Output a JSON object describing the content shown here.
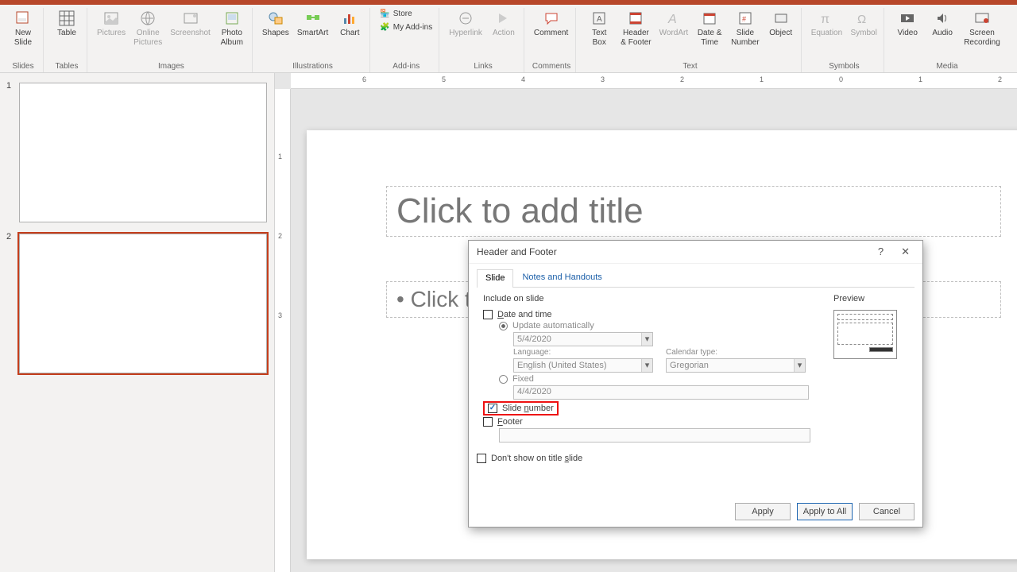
{
  "ribbon": {
    "groups": {
      "slides": {
        "label": "Slides",
        "new_slide": "New\nSlide"
      },
      "tables": {
        "label": "Tables",
        "table": "Table"
      },
      "images": {
        "label": "Images",
        "pictures": "Pictures",
        "online": "Online\nPictures",
        "screenshot": "Screenshot",
        "photo": "Photo\nAlbum"
      },
      "illus": {
        "label": "Illustrations",
        "shapes": "Shapes",
        "smartart": "SmartArt",
        "chart": "Chart"
      },
      "addins": {
        "label": "Add-ins",
        "store": "Store",
        "myaddins": "My Add-ins"
      },
      "links": {
        "label": "Links",
        "hyperlink": "Hyperlink",
        "action": "Action"
      },
      "comments": {
        "label": "Comments",
        "comment": "Comment"
      },
      "text": {
        "label": "Text",
        "textbox": "Text\nBox",
        "hf": "Header\n& Footer",
        "wordart": "WordArt",
        "dt": "Date &\nTime",
        "slidenum": "Slide\nNumber",
        "object": "Object"
      },
      "symbols": {
        "label": "Symbols",
        "equation": "Equation",
        "symbol": "Symbol"
      },
      "media": {
        "label": "Media",
        "video": "Video",
        "audio": "Audio",
        "screc": "Screen\nRecording"
      }
    }
  },
  "ruler": {
    "ticks": [
      "6",
      "5",
      "4",
      "3",
      "2",
      "1",
      "0",
      "1",
      "2"
    ]
  },
  "vruler": {
    "ticks": [
      "",
      "1",
      "",
      "2",
      "",
      "3"
    ]
  },
  "thumbs": {
    "n1": "1",
    "n2": "2"
  },
  "slide": {
    "title": "Click to add title",
    "body": "Click to add text"
  },
  "dialog": {
    "title": "Header and Footer",
    "help": "?",
    "close": "✕",
    "tabs": {
      "slide": "Slide",
      "notes": "Notes and Handouts"
    },
    "include": "Include on slide",
    "dt": "Date and time",
    "upd": "Update automatically",
    "date_auto": "5/4/2020",
    "lang_label": "Language:",
    "lang_val": "English (United States)",
    "cal_label": "Calendar type:",
    "cal_val": "Gregorian",
    "fixed": "Fixed",
    "date_fixed": "4/4/2020",
    "slidenum": "Slide number",
    "footer": "Footer",
    "footer_val": "",
    "dontshow": "Don't show on title slide",
    "preview": "Preview",
    "apply": "Apply",
    "apply_all": "Apply to All",
    "cancel": "Cancel"
  }
}
